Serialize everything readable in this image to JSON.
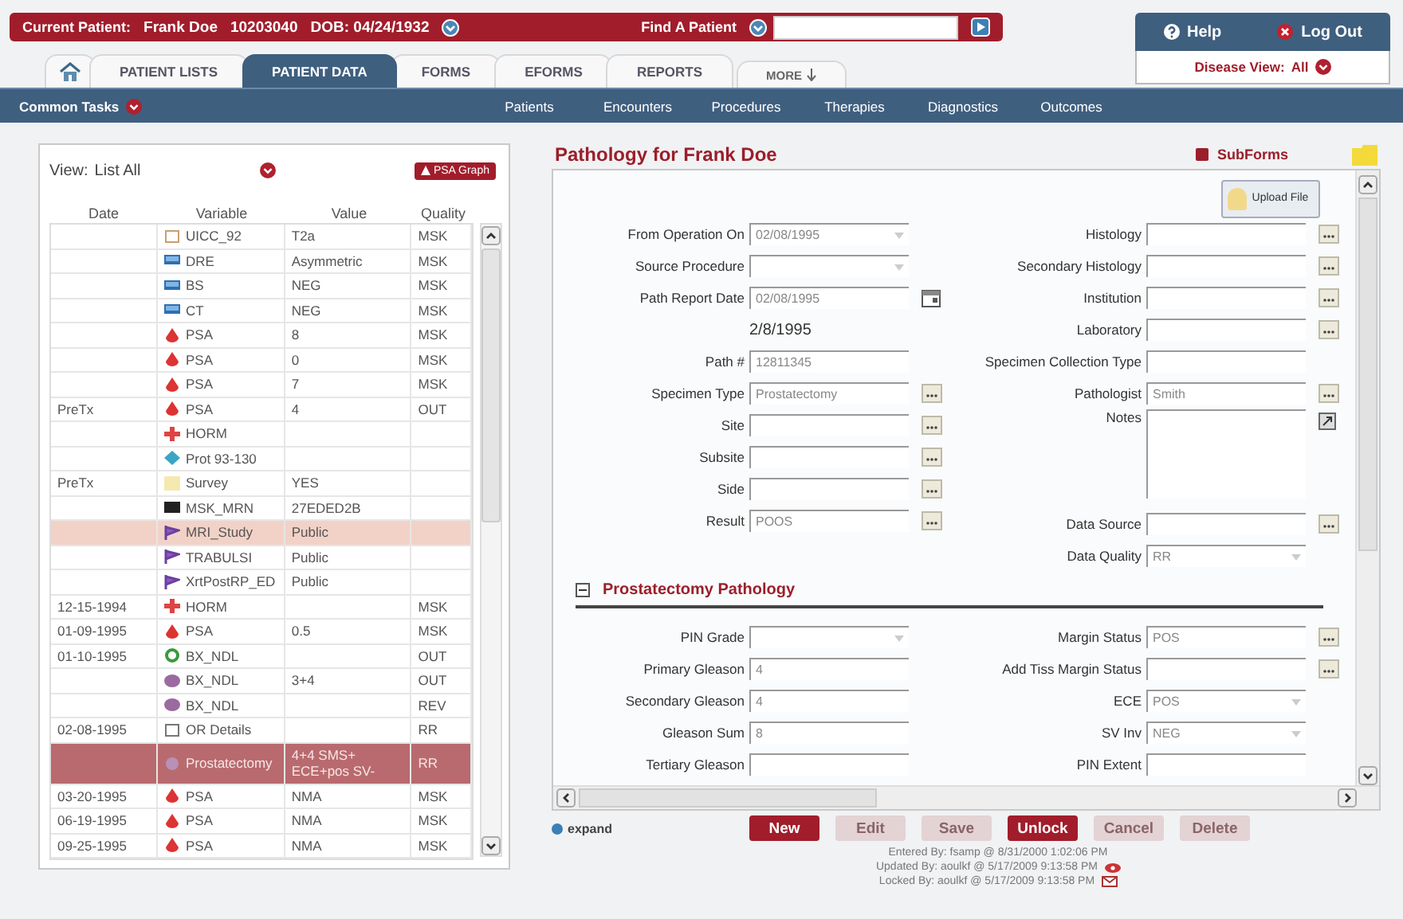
{
  "patient_bar": {
    "label": "Current Patient:",
    "name": "Frank Doe",
    "id": "10203040",
    "dob": "DOB: 04/24/1932",
    "find_label": "Find A Patient"
  },
  "account": {
    "help": "Help",
    "logout": "Log Out",
    "disease_view_label": "Disease View:",
    "disease_view_value": "All"
  },
  "tabs": [
    {
      "kind": "home",
      "selected": false
    },
    {
      "kind": "text",
      "label": "PATIENT LISTS",
      "selected": false
    },
    {
      "kind": "text",
      "label": "PATIENT DATA",
      "selected": true
    },
    {
      "kind": "text",
      "label": "FORMS",
      "selected": false
    },
    {
      "kind": "text",
      "label": "EFORMS",
      "selected": false
    },
    {
      "kind": "text",
      "label": "REPORTS",
      "selected": false
    },
    {
      "kind": "more",
      "label": "MORE",
      "selected": false
    }
  ],
  "nav": {
    "common_tasks": "Common Tasks",
    "items": [
      "Patients",
      "Encounters",
      "Procedures",
      "Therapies",
      "Diagnostics",
      "Outcomes"
    ]
  },
  "view": {
    "label": "View:",
    "value": "List All",
    "graph_button": "PSA Graph"
  },
  "table": {
    "columns": [
      "Date",
      "Variable",
      "Value",
      "Quality"
    ],
    "rows": [
      {
        "kind": "document",
        "variable": "UICC_92",
        "value": "T2a",
        "quality": "MSK",
        "highlighted": false,
        "selected": false
      },
      {
        "kind": "monitor",
        "variable": "DRE",
        "value": "Asymmetric",
        "quality": "MSK",
        "highlighted": false,
        "selected": false
      },
      {
        "kind": "monitor",
        "variable": "BS",
        "value": "NEG",
        "quality": "MSK",
        "highlighted": false,
        "selected": false
      },
      {
        "kind": "monitor",
        "variable": "CT",
        "value": "NEG",
        "quality": "MSK",
        "highlighted": false,
        "selected": false
      },
      {
        "kind": "drop",
        "variable": "PSA",
        "value": "8",
        "quality": "MSK",
        "highlighted": false,
        "selected": false
      },
      {
        "kind": "drop",
        "variable": "PSA",
        "value": "0",
        "quality": "MSK",
        "highlighted": false,
        "selected": false
      },
      {
        "kind": "drop",
        "variable": "PSA",
        "value": "7",
        "quality": "MSK",
        "highlighted": false,
        "selected": false
      },
      {
        "date": "PreTx",
        "kind": "drop",
        "variable": "PSA",
        "value": "4",
        "quality": "OUT",
        "highlighted": false,
        "selected": false
      },
      {
        "kind": "plus",
        "variable": "HORM",
        "highlighted": false,
        "selected": false
      },
      {
        "kind": "pill",
        "variable": "Prot 93-130",
        "highlighted": false,
        "selected": false
      },
      {
        "date": "PreTx",
        "kind": "note",
        "variable": "Survey",
        "value": "YES",
        "highlighted": false,
        "selected": false
      },
      {
        "kind": "card",
        "variable": "MSK_MRN",
        "value": "27EDED2B",
        "highlighted": false,
        "selected": false
      },
      {
        "kind": "flag",
        "variable": "MRI_Study",
        "value": "Public",
        "highlighted": true,
        "selected": false
      },
      {
        "kind": "flag",
        "variable": "TRABULSI",
        "value": "Public",
        "highlighted": false,
        "selected": false
      },
      {
        "kind": "flag",
        "variable": "XrtPostRP_ED",
        "value": "Public",
        "highlighted": false,
        "selected": false
      },
      {
        "date": "12-15-1994",
        "kind": "plus",
        "variable": "HORM",
        "quality": "MSK",
        "highlighted": false,
        "selected": false
      },
      {
        "date": "01-09-1995",
        "kind": "drop",
        "variable": "PSA",
        "value": "0.5",
        "quality": "MSK",
        "highlighted": false,
        "selected": false
      },
      {
        "date": "01-10-1995",
        "kind": "ring",
        "variable": "BX_NDL",
        "quality": "OUT",
        "highlighted": false,
        "selected": false
      },
      {
        "kind": "blob",
        "variable": "BX_NDL",
        "value": "3+4",
        "quality": "OUT",
        "highlighted": false,
        "selected": false
      },
      {
        "kind": "blob",
        "variable": "BX_NDL",
        "quality": "REV",
        "highlighted": false,
        "selected": false
      },
      {
        "date": "02-08-1995",
        "kind": "box",
        "variable": "OR Details",
        "quality": "RR",
        "highlighted": false,
        "selected": false
      },
      {
        "kind": "specimen",
        "variable": "Prostatectomy",
        "value": "4+4 SMS+ ECE+pos SV-",
        "quality": "RR",
        "highlighted": false,
        "selected": true
      },
      {
        "date": "03-20-1995",
        "kind": "drop",
        "variable": "PSA",
        "value": "NMA",
        "quality": "MSK",
        "highlighted": false,
        "selected": false
      },
      {
        "date": "06-19-1995",
        "kind": "drop",
        "variable": "PSA",
        "value": "NMA",
        "quality": "MSK",
        "highlighted": false,
        "selected": false
      },
      {
        "date": "09-25-1995",
        "kind": "drop",
        "variable": "PSA",
        "value": "NMA",
        "quality": "MSK",
        "highlighted": false,
        "selected": false
      }
    ]
  },
  "form": {
    "title": "Pathology for Frank Doe",
    "subforms": "SubForms",
    "upload": "Upload File",
    "left_fields": [
      {
        "label": "From Operation On",
        "value": "02/08/1995",
        "kind": "select"
      },
      {
        "label": "Source Procedure",
        "kind": "select"
      },
      {
        "label": "Path Report Date",
        "value": "02/08/1995",
        "kind": "date"
      },
      {
        "value": "2/8/1995",
        "kind": "note"
      },
      {
        "label": "Path #",
        "value": "12811345",
        "kind": "text"
      },
      {
        "label": "Specimen Type",
        "value": "Prostatectomy",
        "kind": "lookup"
      },
      {
        "label": "Site",
        "kind": "lookup"
      },
      {
        "label": "Subsite",
        "kind": "lookup"
      },
      {
        "label": "Side",
        "kind": "lookup"
      },
      {
        "label": "Result",
        "value": "POOS",
        "kind": "lookup"
      }
    ],
    "right_fields": [
      {
        "label": "Histology",
        "kind": "lookup"
      },
      {
        "label": "Secondary Histology",
        "kind": "lookup"
      },
      {
        "label": "Institution",
        "kind": "lookup"
      },
      {
        "label": "Laboratory",
        "kind": "lookup"
      },
      {
        "label": "Specimen Collection Type",
        "kind": "text"
      },
      {
        "label": "Pathologist",
        "value": "Smith",
        "kind": "lookup"
      },
      {
        "label": "Notes",
        "kind": "notes"
      },
      {
        "label": "Data Source",
        "kind": "lookup"
      },
      {
        "label": "Data Quality",
        "value": "RR",
        "kind": "select"
      }
    ],
    "section": {
      "title": "Prostatectomy Pathology",
      "expanded": true,
      "left_fields": [
        {
          "label": "PIN Grade",
          "kind": "select"
        },
        {
          "label": "Primary Gleason",
          "value": "4",
          "kind": "text"
        },
        {
          "label": "Secondary Gleason",
          "value": "4",
          "kind": "text"
        },
        {
          "label": "Gleason Sum",
          "value": "8",
          "kind": "text"
        },
        {
          "label": "Tertiary Gleason",
          "kind": "text"
        }
      ],
      "right_fields": [
        {
          "label": "Margin Status",
          "value": "POS",
          "kind": "lookup"
        },
        {
          "label": "Add Tiss Margin Status",
          "kind": "lookup"
        },
        {
          "label": "ECE",
          "value": "POS",
          "kind": "select"
        },
        {
          "label": "SV Inv",
          "value": "NEG",
          "kind": "select"
        },
        {
          "label": "PIN Extent",
          "kind": "text"
        }
      ]
    }
  },
  "expand": "expand",
  "buttons": [
    {
      "label": "New",
      "disabled": false
    },
    {
      "label": "Edit",
      "disabled": true
    },
    {
      "label": "Save",
      "disabled": true
    },
    {
      "label": "Unlock",
      "disabled": false
    },
    {
      "label": "Cancel",
      "disabled": true
    },
    {
      "label": "Delete",
      "disabled": true
    }
  ],
  "audit": [
    {
      "text": "Entered By: fsamp @ 8/31/2000 1:02:06 PM",
      "kind": "plain"
    },
    {
      "text": "Updated By: aoulkf @ 5/17/2009 9:13:58 PM",
      "kind": "eye"
    },
    {
      "text": "Locked By: aoulkf @ 5/17/2009 9:13:58 PM",
      "kind": "mail"
    }
  ]
}
